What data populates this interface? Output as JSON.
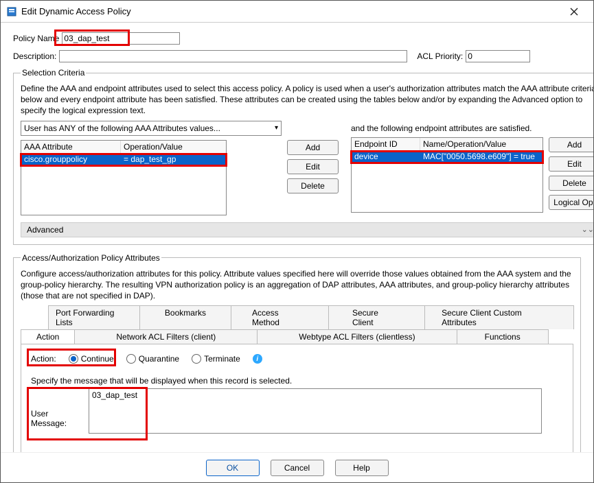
{
  "window": {
    "title": "Edit Dynamic Access Policy"
  },
  "form": {
    "policy_name_label": "Policy Name",
    "policy_name_value": "03_dap_test",
    "description_label": "Description:",
    "description_value": "",
    "acl_priority_label": "ACL Priority:",
    "acl_priority_value": "0"
  },
  "selection": {
    "legend": "Selection Criteria",
    "help": "Define the AAA and endpoint attributes used to select this access policy. A policy is used when a user's authorization attributes match the AAA attribute criteria below and every endpoint attribute has been satisfied. These attributes can be created using the tables below and/or by expanding the Advanced option to specify the logical expression text.",
    "aaa_select": "User has ANY of the following AAA Attributes values...",
    "endpoint_label": "and the following endpoint attributes are satisfied.",
    "aaa_headers": {
      "attr": "AAA Attribute",
      "op": "Operation/Value"
    },
    "aaa_row": {
      "attr": "cisco.grouppolicy",
      "op": "=   dap_test_gp"
    },
    "ep_headers": {
      "id": "Endpoint ID",
      "op": "Name/Operation/Value"
    },
    "ep_row": {
      "id": "device",
      "op": "MAC[\"0050.5698.e609\"]  =  true"
    },
    "advanced": "Advanced"
  },
  "buttons": {
    "add": "Add",
    "edit": "Edit",
    "delete": "Delete",
    "logical": "Logical Op."
  },
  "auth": {
    "legend": "Access/Authorization Policy Attributes",
    "help": "Configure access/authorization attributes for this policy. Attribute values specified here will override those values obtained from the AAA system and the group-policy hierarchy. The resulting VPN authorization policy is an aggregation of DAP attributes, AAA attributes, and group-policy hierarchy attributes (those that are not specified in DAP).",
    "tabs_top": {
      "port": "Port Forwarding Lists",
      "bookmarks": "Bookmarks",
      "access": "Access Method",
      "secure": "Secure Client",
      "custom": "Secure Client Custom Attributes"
    },
    "tabs_bottom": {
      "action": "Action",
      "nacl": "Network ACL Filters (client)",
      "wacl": "Webtype ACL Filters (clientless)",
      "functions": "Functions"
    },
    "action_label": "Action:",
    "opt_continue": "Continue",
    "opt_quarantine": "Quarantine",
    "opt_terminate": "Terminate",
    "msg_help": "Specify the message that will be displayed when this record is selected.",
    "msg_label": "User Message:",
    "msg_value": "03_dap_test"
  },
  "footer": {
    "ok": "OK",
    "cancel": "Cancel",
    "help": "Help"
  }
}
